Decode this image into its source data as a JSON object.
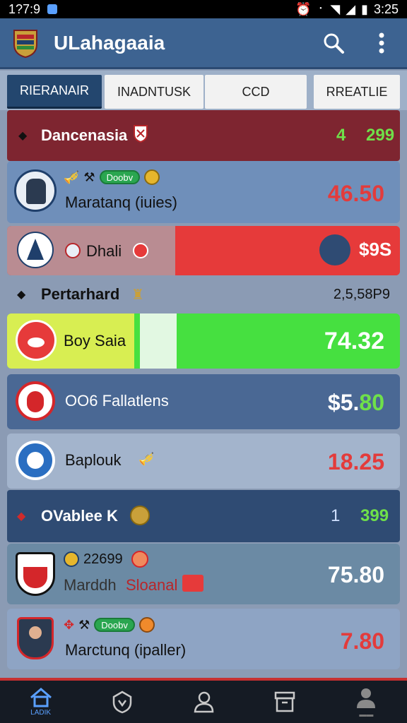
{
  "status": {
    "time": "1?7:9",
    "clock": "3:25"
  },
  "app": {
    "title": "ULahagaaia"
  },
  "tabs": [
    {
      "label": "RIERANAIR"
    },
    {
      "label": "INADNTUSK"
    },
    {
      "label": "CCD"
    },
    {
      "label": "RREATLIE"
    }
  ],
  "sections": {
    "s1": {
      "title": "Dancenasia",
      "count": "4",
      "value": "299"
    },
    "s2": {
      "title": "Pertarhard",
      "value": "2,5,58P9"
    },
    "s3": {
      "title": "OVablee K",
      "count": "1",
      "value": "399"
    }
  },
  "rows": {
    "r1": {
      "pill": "Doobv",
      "name": "Maratanq (iuies)",
      "value": "46.50"
    },
    "r2": {
      "name": "Dhali",
      "value": "$9S"
    },
    "r3": {
      "name": "Boy Saia",
      "value": "74.32"
    },
    "r4": {
      "name": "OO6 Fallatlens",
      "value_prefix": "$5.",
      "value_suffix": "80"
    },
    "r5": {
      "name": "Baplouk",
      "value": "18.25"
    },
    "r6": {
      "code": "22699",
      "name_a": "Marddh",
      "name_b": "Sloanal",
      "value": "75.80"
    },
    "r7": {
      "pill": "Doobv",
      "name": "Marctunq (ipaller)",
      "value": "7.80"
    }
  },
  "nav": {
    "home_label": "LADIK"
  },
  "colors": {
    "appbar": "#3d6391",
    "positive": "#2fd63a",
    "negative": "#e33b3b",
    "section_red": "#7e2530",
    "section_blue": "#2f4b73"
  }
}
